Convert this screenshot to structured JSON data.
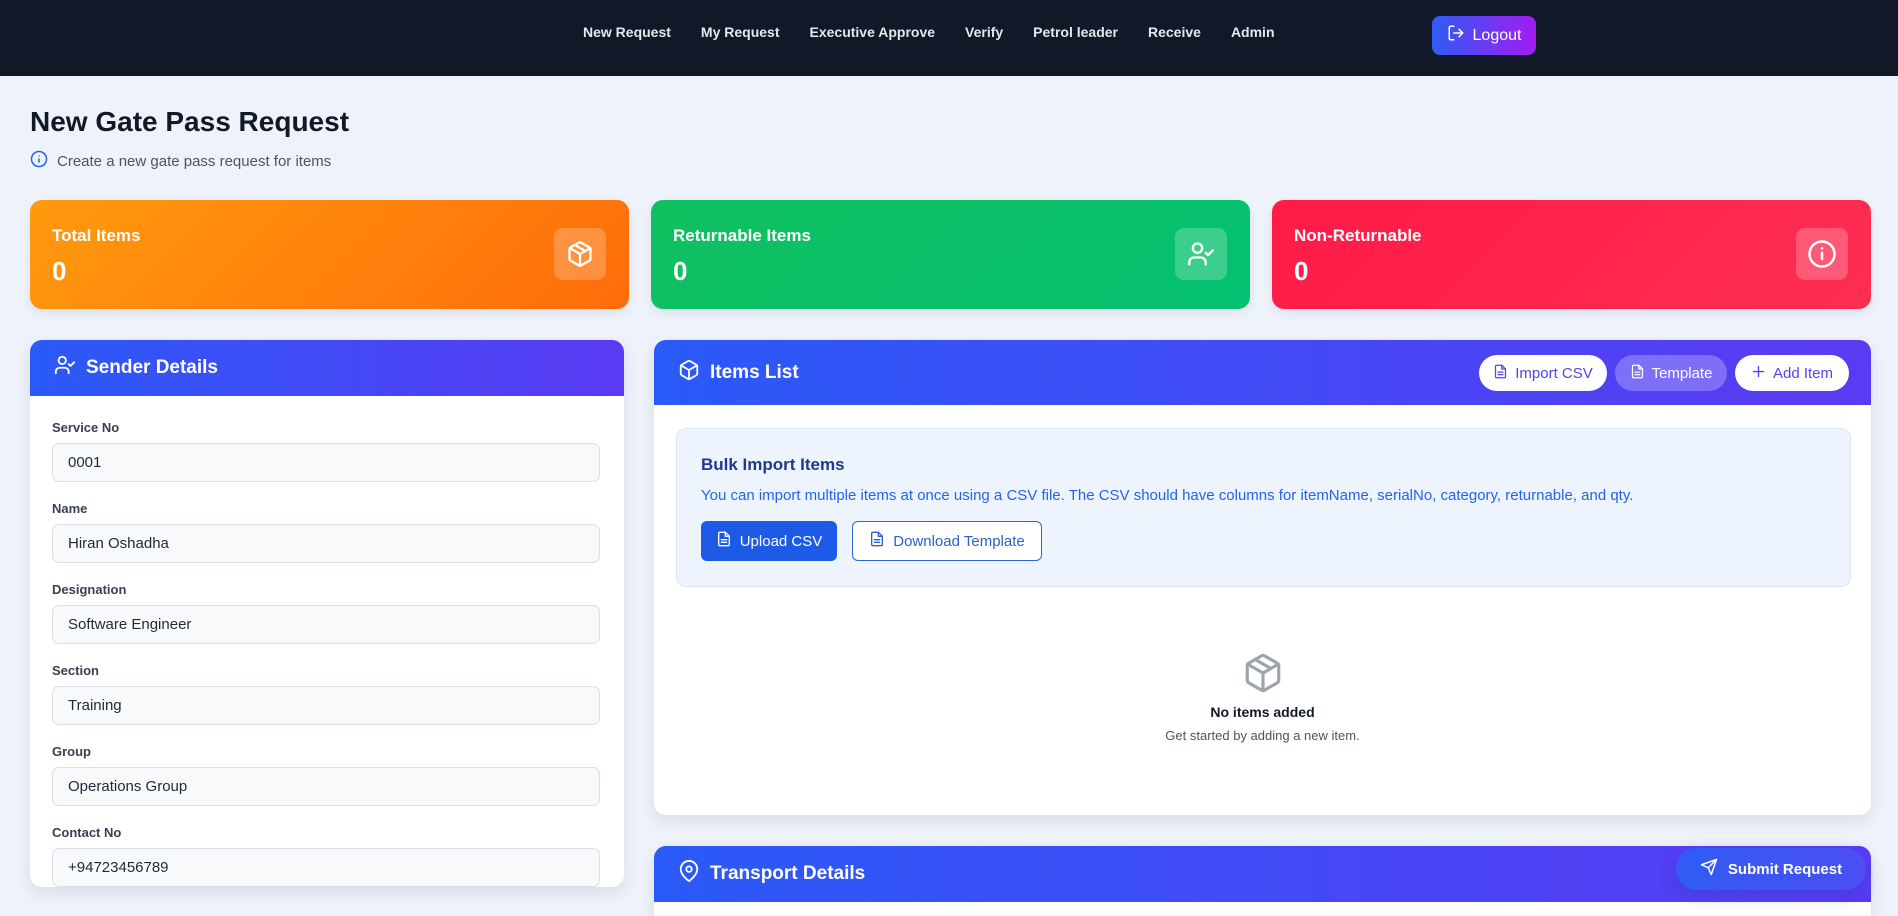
{
  "nav": {
    "items": [
      "New Request",
      "My Request",
      "Executive Approve",
      "Verify",
      "Petrol leader",
      "Receive",
      "Admin"
    ],
    "logout_label": "Logout"
  },
  "header": {
    "title": "New Gate Pass Request",
    "subtitle": "Create a new gate pass request for items"
  },
  "stats": [
    {
      "label": "Total Items",
      "value": "0",
      "icon": "package-icon",
      "color": "#ff8a0c"
    },
    {
      "label": "Returnable Items",
      "value": "0",
      "icon": "user-check-icon",
      "color": "#08c066"
    },
    {
      "label": "Non-Returnable",
      "value": "0",
      "icon": "info-icon",
      "color": "#ff2250"
    }
  ],
  "sender": {
    "title": "Sender Details",
    "fields": [
      {
        "label": "Service No",
        "value": "0001"
      },
      {
        "label": "Name",
        "value": "Hiran Oshadha"
      },
      {
        "label": "Designation",
        "value": "Software Engineer"
      },
      {
        "label": "Section",
        "value": "Training"
      },
      {
        "label": "Group",
        "value": "Operations Group"
      },
      {
        "label": "Contact No",
        "value": "+94723456789"
      }
    ]
  },
  "items": {
    "title": "Items List",
    "import_csv_label": "Import CSV",
    "template_label": "Template",
    "add_item_label": "Add Item",
    "bulk": {
      "title": "Bulk Import Items",
      "description": "You can import multiple items at once using a CSV file. The CSV should have columns for itemName, serialNo, category, returnable, and qty.",
      "upload_label": "Upload CSV",
      "download_label": "Download Template"
    },
    "empty": {
      "title": "No items added",
      "description": "Get started by adding a new item."
    }
  },
  "transport": {
    "title": "Transport Details"
  },
  "submit_label": "Submit Request",
  "colors": {
    "nav_bg": "#111827",
    "accent": "#2a5af7",
    "accent_end": "#5a3af2"
  }
}
